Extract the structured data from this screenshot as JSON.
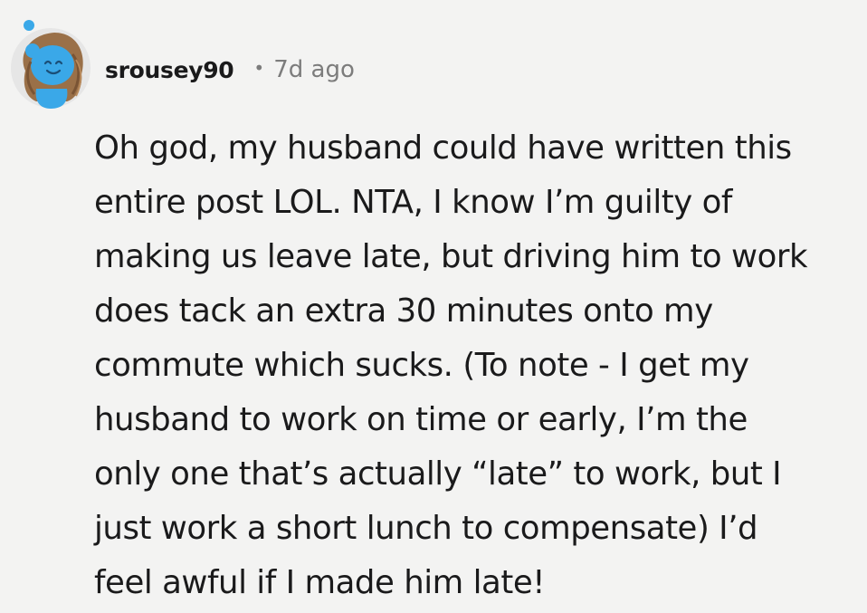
{
  "comment": {
    "author": "srousey90",
    "separator": "•",
    "timestamp": "7d ago",
    "avatar_icon": "snoo-avatar-icon",
    "body_lines": [
      "Oh god, my husband could have written this",
      "entire post LOL. NTA, I know I’m guilty of",
      "making us leave late, but driving him to work",
      "does tack an extra 30 minutes onto my",
      "commute which sucks. (To note - I get my",
      "husband to work on time or early, I’m the",
      "only one that’s actually “late” to work, but I",
      "just work a short lunch to compensate) I’d",
      "feel awful if I made him late!"
    ]
  },
  "colors": {
    "background": "#f3f3f2",
    "text": "#1a1a1b",
    "meta": "#7c7c7c",
    "avatar_blue": "#3aa8e8",
    "avatar_hair": "#9a7048"
  }
}
